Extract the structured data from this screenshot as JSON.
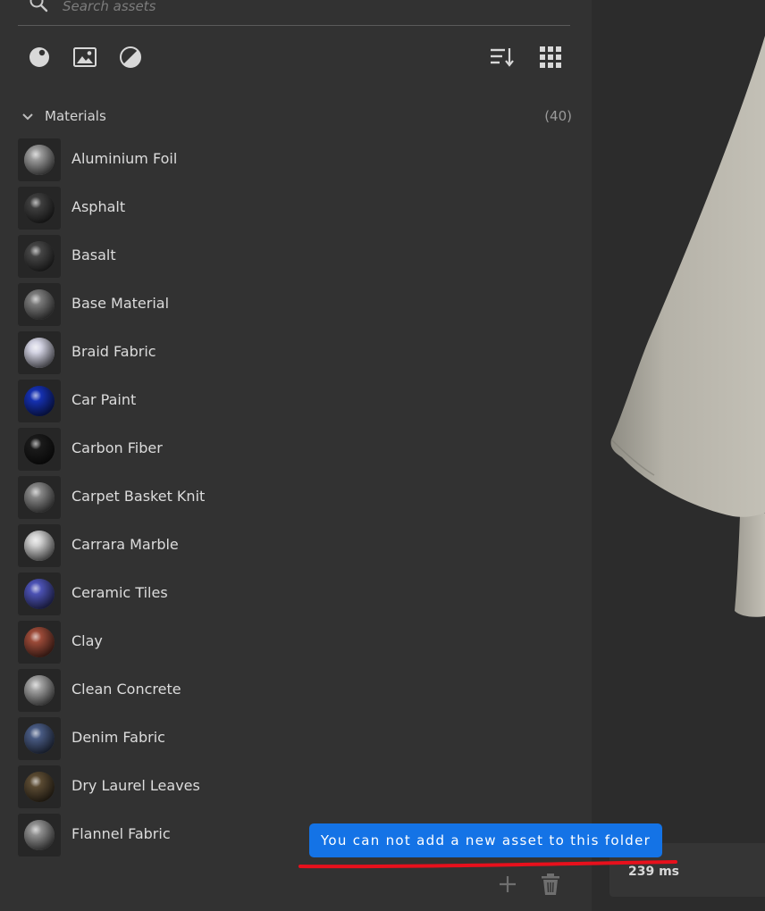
{
  "search": {
    "placeholder": "Search assets"
  },
  "toolbar": {
    "filters": [
      {
        "icon": "material-sphere-icon"
      },
      {
        "icon": "image-icon"
      },
      {
        "icon": "contrast-icon"
      }
    ],
    "sort_icon": "sort-icon",
    "view_icon": "grid-view-icon"
  },
  "section": {
    "title": "Materials",
    "count": "(40)"
  },
  "materials": [
    {
      "name": "Aluminium Foil",
      "color": "#9a9a9a"
    },
    {
      "name": "Asphalt",
      "color": "#3e3e3e"
    },
    {
      "name": "Basalt",
      "color": "#454545"
    },
    {
      "name": "Base Material",
      "color": "#7a7a7a"
    },
    {
      "name": "Braid Fabric",
      "color": "#d2d2e2"
    },
    {
      "name": "Car Paint",
      "color": "#1530b0"
    },
    {
      "name": "Carbon Fiber",
      "color": "#1a1a1a"
    },
    {
      "name": "Carpet Basket Knit",
      "color": "#868686"
    },
    {
      "name": "Carrara Marble",
      "color": "#cfcfcf"
    },
    {
      "name": "Ceramic Tiles",
      "color": "#4c52b4"
    },
    {
      "name": "Clay",
      "color": "#9b4a38"
    },
    {
      "name": "Clean Concrete",
      "color": "#a2a2a2"
    },
    {
      "name": "Denim Fabric",
      "color": "#485a82"
    },
    {
      "name": "Dry Laurel Leaves",
      "color": "#5a4a32"
    },
    {
      "name": "Flannel Fabric",
      "color": "#8f8f8f"
    }
  ],
  "actions": {
    "add_icon": "plus-icon",
    "delete_icon": "trash-icon"
  },
  "toast": {
    "message": "You can not add a new asset to this folder",
    "color": "#1473e6"
  },
  "viewport": {
    "timing": "239 ms",
    "model_color": "#b7b4aa"
  },
  "annotation": {
    "color": "#e8101c"
  }
}
